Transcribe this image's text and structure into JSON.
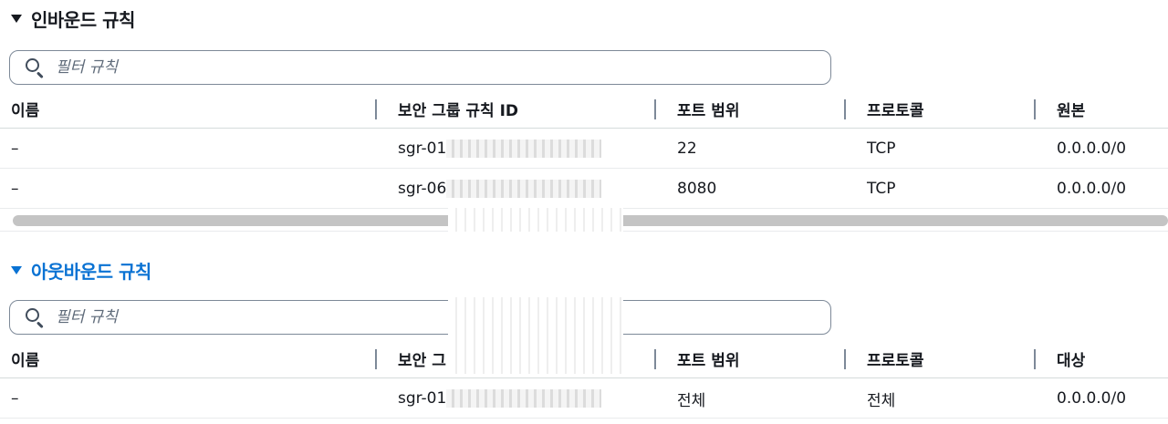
{
  "inbound": {
    "title": "인바운드 규칙",
    "filter_placeholder": "필터 규칙",
    "columns": [
      "이름",
      "보안 그룹 규칙 ID",
      "포트 범위",
      "프로토콜",
      "원본"
    ],
    "rows": [
      {
        "name": "–",
        "rule_id_prefix": "sgr-01",
        "port": "22",
        "protocol": "TCP",
        "source": "0.0.0.0/0"
      },
      {
        "name": "–",
        "rule_id_prefix": "sgr-06",
        "port": "8080",
        "protocol": "TCP",
        "source": "0.0.0.0/0"
      }
    ]
  },
  "outbound": {
    "title": "아웃바운드 규칙",
    "filter_placeholder": "필터 규칙",
    "columns": [
      "이름",
      "보안 그",
      "포트 범위",
      "프로토콜",
      "대상"
    ],
    "rows": [
      {
        "name": "–",
        "rule_id_prefix": "sgr-01",
        "port": "전체",
        "protocol": "전체",
        "destination": "0.0.0.0/0"
      }
    ]
  },
  "colors": {
    "accent": "#0972d3",
    "text": "#16191f",
    "border": "#7d8998"
  },
  "icons": [
    "caret-down-icon",
    "search-icon"
  ]
}
